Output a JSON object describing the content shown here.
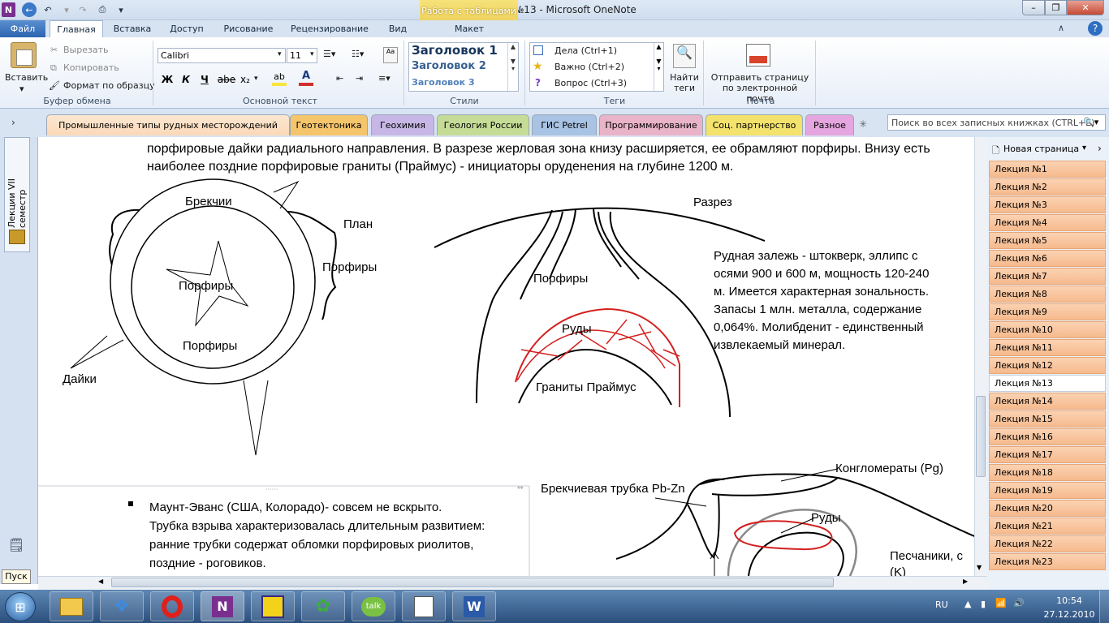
{
  "window": {
    "title": "Лекция №13  -  Microsoft OneNote",
    "context_tab": "Работа с таблицами"
  },
  "tabs": {
    "file": "Файл",
    "items": [
      "Главная",
      "Вставка",
      "Доступ",
      "Рисование",
      "Рецензирование",
      "Вид",
      "Макет"
    ]
  },
  "ribbon": {
    "clipboard": {
      "paste": "Вставить",
      "cut": "Вырезать",
      "copy": "Копировать",
      "format_painter": "Формат по образцу",
      "label": "Буфер обмена"
    },
    "font": {
      "name": "Calibri",
      "size": "11",
      "label": "Основной текст",
      "bold": "Ж",
      "italic": "К",
      "underline": "Ч",
      "strike": "abe",
      "subscript": "x₂"
    },
    "styles": {
      "h1": "Заголовок 1",
      "h2": "Заголовок 2",
      "h3": "Заголовок 3",
      "label": "Стили"
    },
    "tags": {
      "t1": "Дела (Ctrl+1)",
      "t2": "Важно (Ctrl+2)",
      "t3": "Вопрос (Ctrl+3)",
      "find": "Найти теги",
      "label": "Теги"
    },
    "mail": {
      "send": "Отправить страницу по электронной почте",
      "label": "Почта"
    }
  },
  "sections": [
    {
      "name": "Промышленные типы рудных месторождений",
      "color": "#fbd9b8"
    },
    {
      "name": "Геотектоника",
      "color": "#f5c56c"
    },
    {
      "name": "Геохимия",
      "color": "#c7b7e6"
    },
    {
      "name": "Геология России",
      "color": "#c5dc97"
    },
    {
      "name": "ГИС Petrel",
      "color": "#a8c3e3"
    },
    {
      "name": "Программирование",
      "color": "#e9b3c8"
    },
    {
      "name": "Соц. партнерство",
      "color": "#f3e26c"
    },
    {
      "name": "Разное",
      "color": "#e5a6e0"
    }
  ],
  "search_placeholder": "Поиск во всех записных книжках (CTRL+E)",
  "notebook_name": "Лекции VII семестр",
  "new_page": "Новая страница",
  "pages": [
    "Лекция №1",
    "Лекция №2",
    "Лекция №3",
    "Лекция №4",
    "Лекция №5",
    "Лекция №6",
    "Лекция №7",
    "Лекция №8",
    "Лекция №9",
    "Лекция №10",
    "Лекция №11",
    "Лекция №12",
    "Лекция №13",
    "Лекция №14",
    "Лекция №15",
    "Лекция №16",
    "Лекция №17",
    "Лекция №18",
    "Лекция №19",
    "Лекция №20",
    "Лекция №21",
    "Лекция №22",
    "Лекция №23"
  ],
  "active_page_index": 12,
  "content": {
    "top_line1": "порфировые дайки радиального направления. В разрезе жерловая зона книзу расширяется, ее обрамляют порфиры. Внизу есть",
    "top_line2": "наиболее поздние порфировые граниты (Праймус) - инициаторы оруденения на глубине 1200 м.",
    "plan": {
      "brekchii": "Брекчии",
      "plan": "План",
      "porfiry_right": "Порфиры",
      "porfiry_center": "Порфиры",
      "porfiry_bottom": "Порфиры",
      "daiki": "Дайки"
    },
    "section": {
      "title": "Разрез",
      "porfiry": "Порфиры",
      "rudy": "Руды",
      "granity": "Граниты Праймус"
    },
    "description": [
      "Рудная залежь - штокверк, эллипс с",
      "осями 900 и 600 м, мощность 120-240",
      "м. Имеется характерная зональность.",
      "Запасы 1 млн. металла, содержание",
      "0,064%.  Молибденит - единственный",
      "извлекаемый минерал."
    ],
    "bullet": [
      "Маунт-Эванс (США, Колорадо)- совсем не вскрыто.",
      "Трубка взрыва характеризовалась длительным развитием:",
      "ранние трубки содержат обломки порфировых риолитов,",
      "поздние - роговиков."
    ],
    "diagram2": {
      "konglomeraty": "Конгломераты (Pg)",
      "trubka": "Брекчиевая трубка Pb-Zn",
      "rudy": "Руды",
      "peschaniki": "Песчаники, с",
      "k": "(K)"
    }
  },
  "tooltip": "Пуск",
  "tray": {
    "lang": "RU",
    "time": "10:54",
    "date": "27.12.2010"
  }
}
